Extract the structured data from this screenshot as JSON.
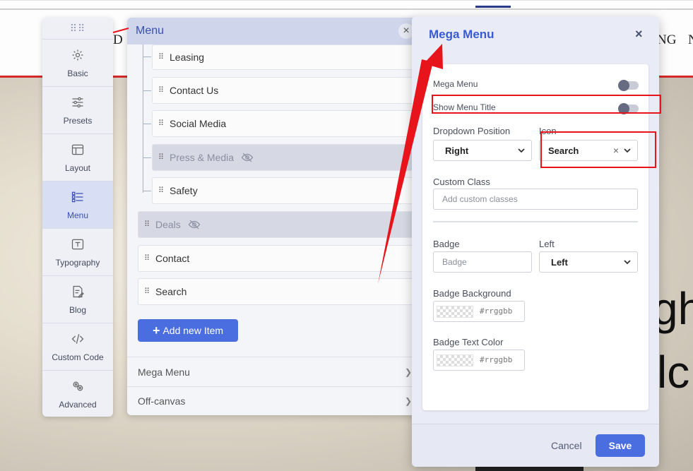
{
  "background": {
    "nav_fragment_left": "D",
    "nav_fragment_right_1": "NG",
    "nav_fragment_right_2": "N",
    "hero_fragment_1": "gh",
    "hero_fragment_2": "lc"
  },
  "toolbar": {
    "items": [
      {
        "label": "Basic",
        "icon": "gear-icon"
      },
      {
        "label": "Presets",
        "icon": "sliders-icon"
      },
      {
        "label": "Layout",
        "icon": "layout-icon"
      },
      {
        "label": "Menu",
        "icon": "menu-list-icon",
        "active": true
      },
      {
        "label": "Typography",
        "icon": "text-icon"
      },
      {
        "label": "Blog",
        "icon": "edit-document-icon"
      },
      {
        "label": "Custom Code",
        "icon": "code-icon"
      },
      {
        "label": "Advanced",
        "icon": "gears-icon"
      }
    ]
  },
  "menu_panel": {
    "title": "Menu",
    "close": "×",
    "children": [
      {
        "label": "Leasing",
        "hidden": false
      },
      {
        "label": "Contact Us",
        "hidden": false
      },
      {
        "label": "Social Media",
        "hidden": false
      },
      {
        "label": "Press & Media",
        "hidden": true
      },
      {
        "label": "Safety",
        "hidden": false
      }
    ],
    "top_items": [
      {
        "label": "Deals",
        "hidden": true
      },
      {
        "label": "Contact",
        "hidden": false
      },
      {
        "label": "Search",
        "hidden": false
      }
    ],
    "add_button": "Add new Item",
    "add_button_icon": "plus-icon",
    "accordions": [
      {
        "label": "Mega Menu"
      },
      {
        "label": "Off-canvas"
      }
    ]
  },
  "dialog": {
    "title": "Mega Menu",
    "close": "×",
    "mega_menu_label": "Mega Menu",
    "show_menu_title_label": "Show Menu Title",
    "dropdown_position_label": "Dropdown Position",
    "dropdown_position_value": "Right",
    "icon_label": "Icon",
    "icon_value": "Search",
    "icon_clear": "×",
    "custom_class_label": "Custom Class",
    "custom_class_placeholder": "Add custom classes",
    "badge_label": "Badge",
    "badge_placeholder": "Badge",
    "badge_position_label": "Left",
    "badge_position_value": "Left",
    "badge_bg_label": "Badge Background",
    "badge_bg_value": "#rrggbb",
    "badge_text_color_label": "Badge Text Color",
    "badge_text_color_value": "#rrggbb",
    "cancel": "Cancel",
    "save": "Save"
  },
  "colors": {
    "accent": "#4a6ee0",
    "title_blue": "#3a5bd0",
    "annotation_red": "#e8141c"
  }
}
